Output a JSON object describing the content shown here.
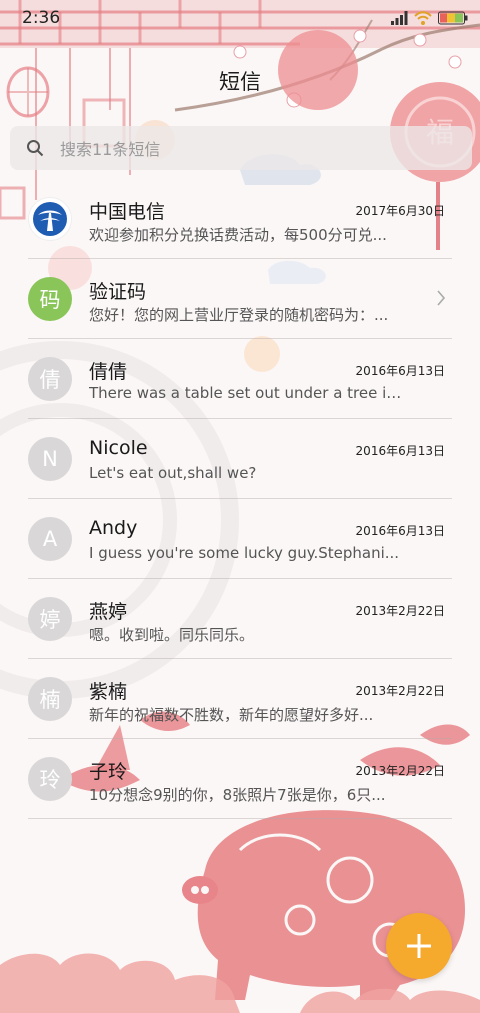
{
  "status_bar": {
    "time": "2:36"
  },
  "header": {
    "title": "短信"
  },
  "search": {
    "placeholder": "搜索11条短信"
  },
  "conversations": [
    {
      "avatar": "",
      "name": "中国电信",
      "date": "2017年6月30日",
      "preview": "欢迎参加积分兑换话费活动，每500分可兑..."
    },
    {
      "avatar": "码",
      "name": "验证码",
      "date": "",
      "preview": "您好！您的网上营业厅登录的随机密码为：..."
    },
    {
      "avatar": "倩",
      "name": "倩倩",
      "date": "2016年6月13日",
      "preview": "There was a table set out under a tree in..."
    },
    {
      "avatar": "N",
      "name": "Nicole",
      "date": "2016年6月13日",
      "preview": "Let's eat out,shall we?"
    },
    {
      "avatar": "A",
      "name": "Andy",
      "date": "2016年6月13日",
      "preview": "I guess you're some lucky guy.Stephani..."
    },
    {
      "avatar": "婷",
      "name": "燕婷",
      "date": "2013年2月22日",
      "preview": "嗯。收到啦。同乐同乐。"
    },
    {
      "avatar": "楠",
      "name": "紫楠",
      "date": "2013年2月22日",
      "preview": "新年的祝福数不胜数，新年的愿望好多好..."
    },
    {
      "avatar": "玲",
      "name": "子玲",
      "date": "2013年2月22日",
      "preview": "10分想念9别的你，8张照片7张是你，6只..."
    }
  ],
  "fab": {
    "icon": "plus-icon"
  },
  "theme": {
    "accent": "#f5a92d",
    "paper_cut": "#e8858a",
    "avatar_green": "#8ac55a"
  }
}
